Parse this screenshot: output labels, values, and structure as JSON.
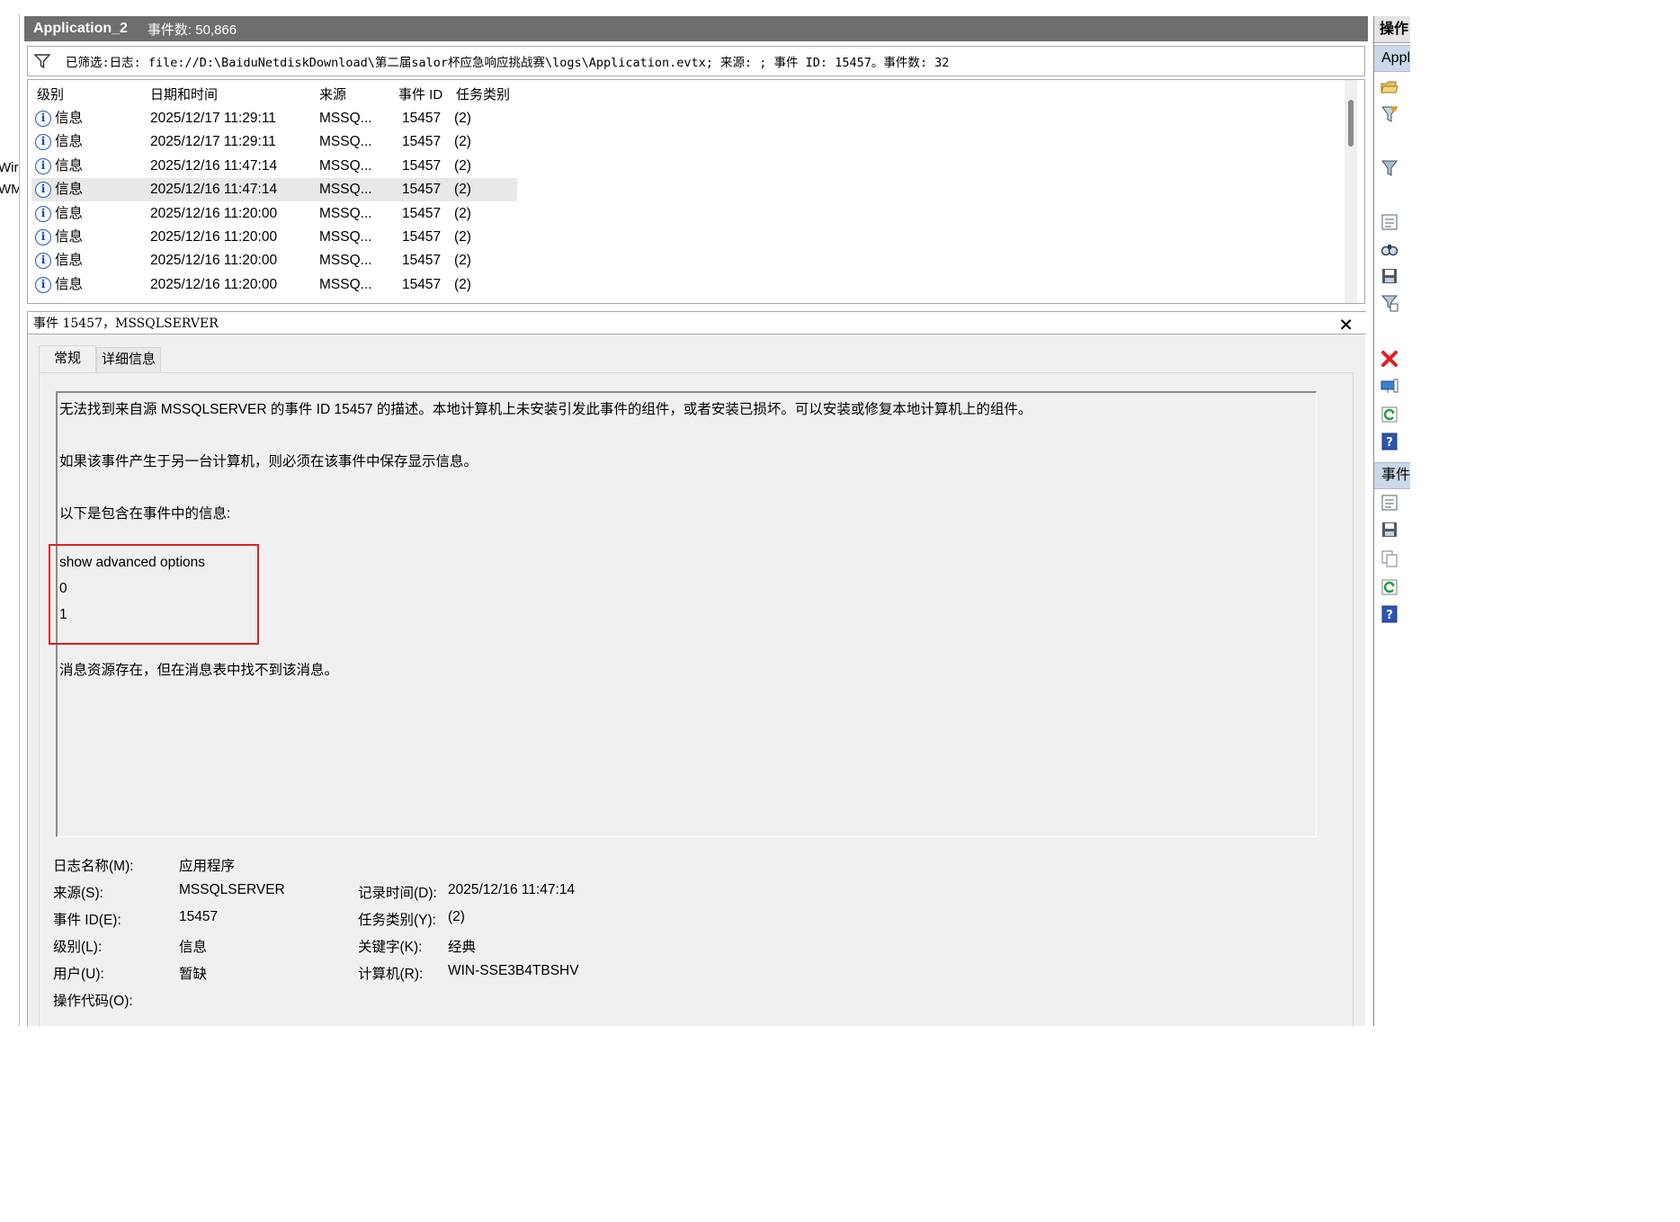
{
  "left_pane": {
    "lines": [
      "Wir",
      "WM"
    ]
  },
  "header": {
    "title": "Application_2",
    "event_count": "事件数: 50,866"
  },
  "filter": {
    "text": "已筛选:日志: file://D:\\BaiduNetdiskDownload\\第二届salor杯应急响应挑战赛\\logs\\Application.evtx; 来源: ; 事件 ID: 15457。事件数: 32"
  },
  "event_list": {
    "columns": [
      "级别",
      "日期和时间",
      "来源",
      "事件 ID",
      "任务类别"
    ],
    "rows": [
      {
        "level": "信息",
        "datetime": "2025/12/17 11:29:11",
        "source": "MSSQ...",
        "event_id": "15457",
        "task": "(2)",
        "selected": false
      },
      {
        "level": "信息",
        "datetime": "2025/12/17 11:29:11",
        "source": "MSSQ...",
        "event_id": "15457",
        "task": "(2)",
        "selected": false
      },
      {
        "level": "信息",
        "datetime": "2025/12/16 11:47:14",
        "source": "MSSQ...",
        "event_id": "15457",
        "task": "(2)",
        "selected": false
      },
      {
        "level": "信息",
        "datetime": "2025/12/16 11:47:14",
        "source": "MSSQ...",
        "event_id": "15457",
        "task": "(2)",
        "selected": true
      },
      {
        "level": "信息",
        "datetime": "2025/12/16 11:20:00",
        "source": "MSSQ...",
        "event_id": "15457",
        "task": "(2)",
        "selected": false
      },
      {
        "level": "信息",
        "datetime": "2025/12/16 11:20:00",
        "source": "MSSQ...",
        "event_id": "15457",
        "task": "(2)",
        "selected": false
      },
      {
        "level": "信息",
        "datetime": "2025/12/16 11:20:00",
        "source": "MSSQ...",
        "event_id": "15457",
        "task": "(2)",
        "selected": false
      },
      {
        "level": "信息",
        "datetime": "2025/12/16 11:20:00",
        "source": "MSSQ...",
        "event_id": "15457",
        "task": "(2)",
        "selected": false
      }
    ]
  },
  "detail": {
    "title": "事件 15457，MSSQLSERVER",
    "close_symbol": "×",
    "tabs": [
      "常规",
      "详细信息"
    ],
    "description": [
      "无法找到来自源 MSSQLSERVER 的事件 ID 15457 的描述。本地计算机上未安装引发此事件的组件，或者安装已损坏。可以安装或修复本地计算机上的组件。",
      "如果该事件产生于另一台计算机，则必须在该事件中保存显示信息。",
      "以下是包含在事件中的信息:",
      "show advanced options",
      "0",
      "1",
      "消息资源存在，但在消息表中找不到该消息。"
    ],
    "properties": {
      "log_name_label": "日志名称(M):",
      "log_name_value": "应用程序",
      "source_label": "来源(S):",
      "source_value": "MSSQLSERVER",
      "logged_label": "记录时间(D):",
      "logged_value": "2025/12/16 11:47:14",
      "event_id_label": "事件 ID(E):",
      "event_id_value": "15457",
      "task_label": "任务类别(Y):",
      "task_value": "(2)",
      "level_label": "级别(L):",
      "level_value": "信息",
      "keywords_label": "关键字(K):",
      "keywords_value": "经典",
      "user_label": "用户(U):",
      "user_value": "暂缺",
      "computer_label": "计算机(R):",
      "computer_value": "WIN-SSE3B4TBSHV",
      "opcode_label": "操作代码(O):"
    }
  },
  "actions": {
    "header": "操作",
    "section1": "Appl",
    "section2": "事件",
    "icons1": [
      "open-folder-icon",
      "filter-icon",
      "funnel-icon",
      "properties-icon",
      "find-icon",
      "save-icon",
      "attach-task-icon",
      "delete-icon",
      "view-icon",
      "refresh-icon",
      "help-icon"
    ],
    "icons2": [
      "event-properties-icon",
      "save-icon",
      "copy-icon",
      "refresh-icon",
      "help-icon"
    ]
  },
  "colors": {
    "header_bg": "#6e6e6e",
    "highlight": "#e02020",
    "section_bg": "#c9d8ea"
  }
}
